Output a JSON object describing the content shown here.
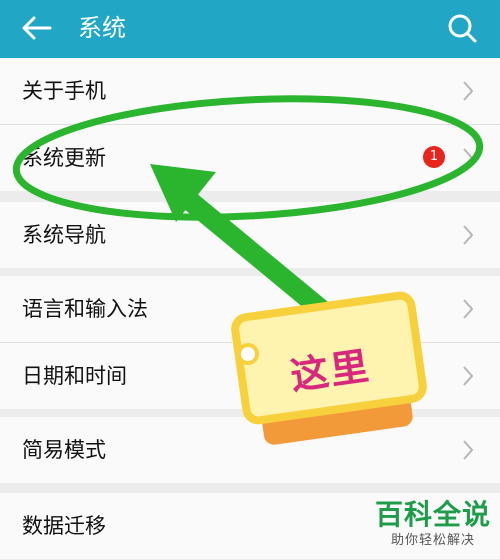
{
  "header": {
    "title": "系统",
    "back_icon": "arrow-left-icon",
    "search_icon": "search-icon",
    "background": "#21a6c6"
  },
  "groups": [
    {
      "items": [
        {
          "label": "关于手机"
        },
        {
          "label": "系统更新",
          "badge": "1"
        }
      ]
    },
    {
      "items": [
        {
          "label": "系统导航"
        }
      ]
    },
    {
      "items": [
        {
          "label": "语言和输入法"
        },
        {
          "label": "日期和时间"
        }
      ]
    },
    {
      "items": [
        {
          "label": "简易模式"
        }
      ]
    },
    {
      "items": [
        {
          "label": "数据迁移"
        }
      ]
    }
  ],
  "annotation": {
    "tag_text": "这里",
    "highlight_color": "#2bb52f",
    "tag_text_color": "#d8287e"
  },
  "watermark": {
    "title": "百科全说",
    "subtitle": "助你轻松解决"
  }
}
